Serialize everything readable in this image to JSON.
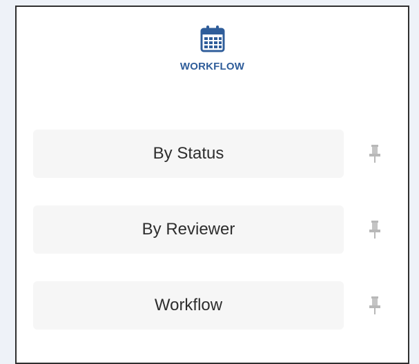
{
  "header": {
    "icon": "calendar-icon",
    "title": "WORKFLOW",
    "accent_color": "#2f5d9a"
  },
  "nav_items": [
    {
      "label": "By Status",
      "pin_icon": "pin-icon"
    },
    {
      "label": "By Reviewer",
      "pin_icon": "pin-icon"
    },
    {
      "label": "Workflow",
      "pin_icon": "pin-icon"
    }
  ]
}
